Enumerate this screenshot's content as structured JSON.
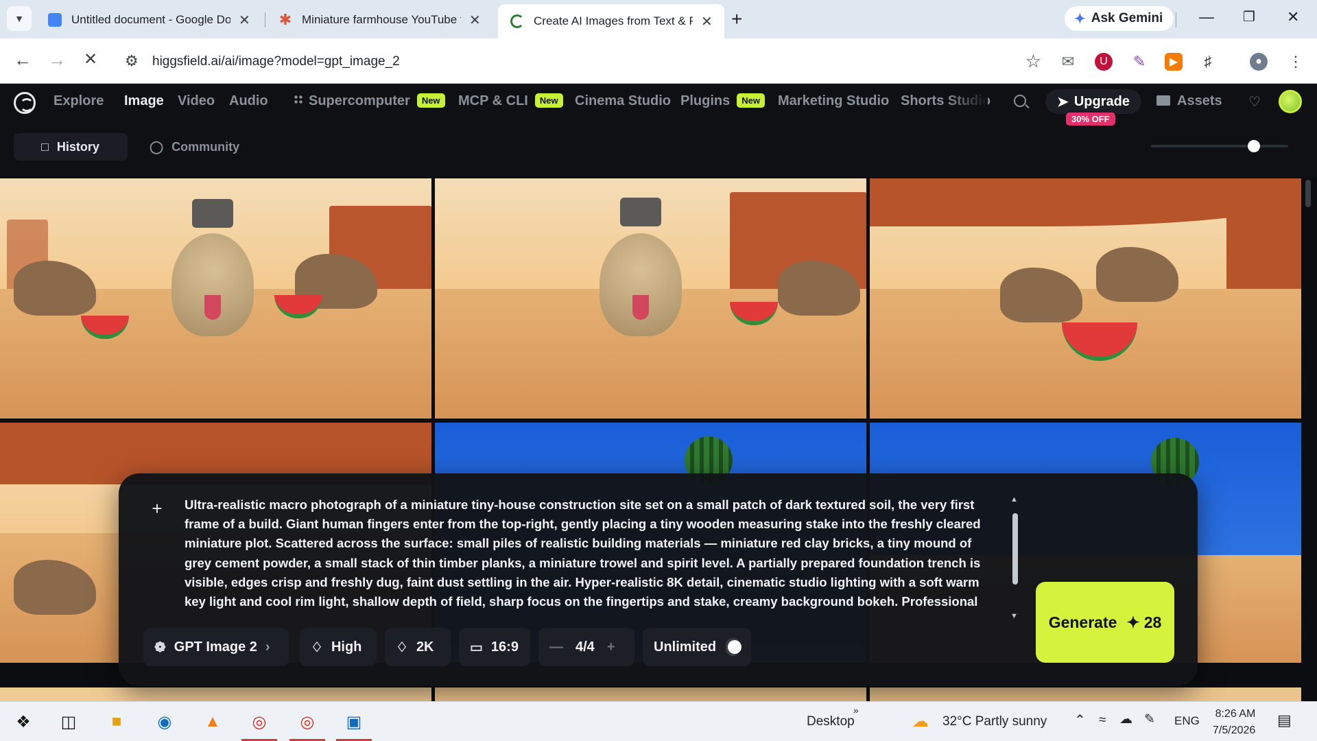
{
  "browser": {
    "tabs": [
      {
        "title": "Untitled document - Google Do",
        "favicon_color": "#4285f4"
      },
      {
        "title": "Miniature farmhouse YouTube t",
        "favicon_color": "#d9573b"
      },
      {
        "title": "Create AI Images from Text & P",
        "favicon_color": "#2e7d32"
      }
    ],
    "ask_gemini": "Ask Gemini",
    "url": "higgsfield.ai/ai/image?model=gpt_image_2"
  },
  "site_nav": {
    "links": [
      "Explore",
      "Image",
      "Video",
      "Audio",
      "Supercomputer",
      "MCP & CLI",
      "Cinema Studio",
      "Plugins",
      "Marketing Studio",
      "Shorts Studio"
    ],
    "new_badge": "New",
    "upgrade": "Upgrade",
    "discount": "30% OFF",
    "assets": "Assets"
  },
  "subtabs": {
    "history": "History",
    "community": "Community"
  },
  "zoom_slider_level": 0.75,
  "prompt": {
    "text": "Ultra-realistic macro photograph of a miniature tiny-house construction site set on a small patch of dark textured soil, the very first frame of a build. Giant human fingers enter from the top-right, gently placing a tiny wooden measuring stake into the freshly cleared miniature plot. Scattered across the surface: small piles of realistic building materials — miniature red clay bricks, a tiny mound of grey cement powder, a small stack of thin timber planks, a miniature trowel and spirit level. A partially prepared foundation trench is visible, edges crisp and freshly dug, faint dust settling in the air. Hyper-realistic 8K detail, cinematic studio lighting with a soft warm key light and cool rim light, shallow depth of field, sharp focus on the fingertips and stake, creamy background bokeh. Professional product photography, photorealistic miniature craft, no cartoonish look, detailed textures, visible dust and grain, realistic soft shadows, and the subject"
  },
  "controls": {
    "model": "GPT Image 2",
    "quality": "High",
    "resolution": "2K",
    "aspect": "16:9",
    "count": "4/4",
    "unlimited": "Unlimited",
    "unlimited_enabled": false,
    "generate": "Generate",
    "generate_cost": "28"
  },
  "taskbar": {
    "desktop": "Desktop",
    "weather": "32°C  Partly sunny",
    "lang": "ENG",
    "time": "8:26 AM",
    "date": "7/5/2026"
  }
}
